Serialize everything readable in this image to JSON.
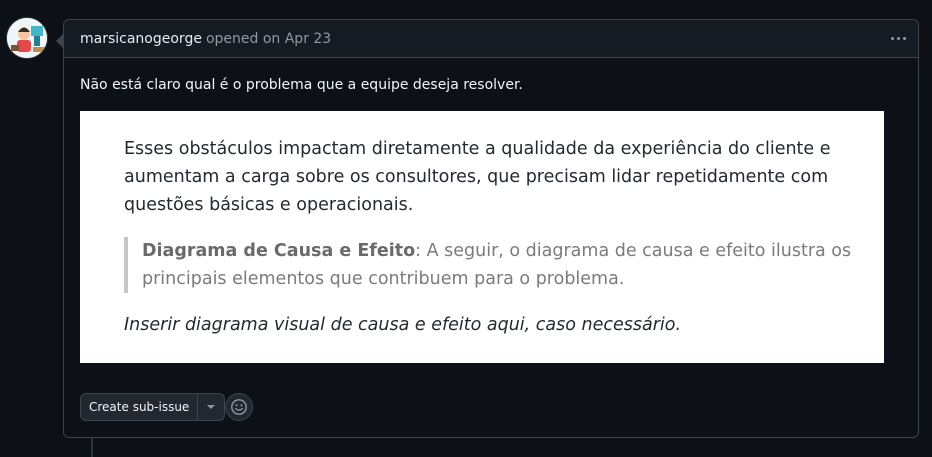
{
  "comment": {
    "author": "marsicanogeorge",
    "meta": "opened on Apr 23",
    "body": "Não está claro qual é o problema que a equipe deseja resolver."
  },
  "embedded_doc": {
    "paragraph": "Esses obstáculos impactam diretamente a qualidade da experiência do cliente e aumentam a carga sobre os consultores, que precisam lidar repetidamente com questões básicas e operacionais.",
    "quote_title": "Diagrama de Causa e Efeito",
    "quote_text": ": A seguir, o diagrama de causa e efeito ilustra os principais elementos que contribuem para o problema.",
    "italic_note": "Inserir diagrama visual de causa e efeito aqui, caso necessário."
  },
  "actions": {
    "create_subissue": "Create sub-issue"
  },
  "colors": {
    "background": "#0d1117",
    "header": "#151b23",
    "border": "#3d444d"
  }
}
